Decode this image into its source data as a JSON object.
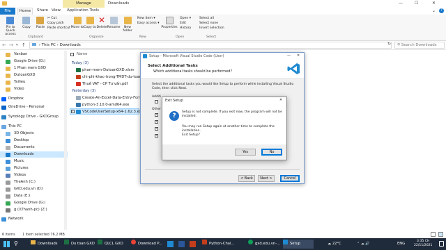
{
  "window": {
    "manage_tab": "Manage",
    "title": "Downloads",
    "minimize": "—",
    "maximize": "☐",
    "close": "✕"
  },
  "ribbon_tabs": [
    "File",
    "Home",
    "Share",
    "View",
    "Application Tools"
  ],
  "ribbon": {
    "pin_label": "Pin to Quick access",
    "copy_label": "Copy",
    "paste_label": "Paste",
    "cut": "Cut",
    "copy_path": "Copy path",
    "paste_shortcut": "Paste shortcut",
    "clipboard_group": "Clipboard",
    "move_to": "Move to",
    "copy_to": "Copy to",
    "delete": "Delete",
    "rename": "Rename",
    "organize_group": "Organize",
    "new_folder": "New folder",
    "new_item": "New item",
    "easy_access": "Easy access",
    "new_group": "New",
    "properties": "Properties",
    "open": "Open",
    "edit": "Edit",
    "history": "History",
    "open_group": "Open",
    "select_all": "Select all",
    "select_none": "Select none",
    "invert_selection": "Invert selection",
    "select_group": "Select"
  },
  "address": {
    "path": [
      "This PC",
      "Downloads"
    ],
    "search_placeholder": "Search Downloads"
  },
  "nav": [
    "Vanban",
    "Google Drive (G:)",
    "1 Phan mem GXD",
    "DutoanGXD",
    "Tailieu",
    "Video",
    "Dropbox",
    "OneDrive - Personal",
    "Synology Drive - GXDGroup",
    "This PC",
    "3D Objects",
    "Desktop",
    "Documents",
    "Downloads",
    "Music",
    "Pictures",
    "Videos",
    "TheAnh (C:)",
    "GXD.edu.vn (D:)",
    "Data (E:)",
    "Google Drive (G:)",
    "g (\\\\Thanh-pc) (Z:)",
    "Network"
  ],
  "list": {
    "column_name": "Name",
    "group_today": "Today (3)",
    "today": [
      "phan-mem-DutoanGXD.xlsm",
      "chi-phi-khac-trong-TMDT-du-toan.pptx",
      "Thuế VAT - CP Tư vấn.pdf"
    ],
    "group_yesterday": "Yesterday (3)",
    "yesterday": [
      "Create-An-Excel-Data-Entry-Form-With",
      "python-3.10.0-amd64.exe",
      "VSCodeUserSetup-x64-1.62.3.exe"
    ]
  },
  "setup": {
    "title": "Setup - Microsoft Visual Studio Code (User)",
    "heading": "Select Additional Tasks",
    "subheading": "Which additional tasks should be performed?",
    "body": "Select the additional tasks you would like Setup to perform while installing Visual Studio Code, then click Next.",
    "label_additional": "Additi",
    "label_other": "Other",
    "back": "< Back",
    "next": "Next >",
    "cancel": "Cancel"
  },
  "exit_dialog": {
    "title": "Exit Setup",
    "message": "Setup is not complete. If you exit now, the program will not be installed.",
    "message2": "You may run Setup again at another time to complete the installation.",
    "question": "Exit Setup?",
    "yes": "Yes",
    "no": "No",
    "close": "✕"
  },
  "status": {
    "items": "6 items",
    "selected": "1 item selected  76.2 MB"
  },
  "taskbar": {
    "apps": [
      "Downloads",
      "Du toan GXD",
      "QLCL GXD",
      "Download P...",
      "Python-Chal...",
      "gxd.edu.vn-...",
      "Setup"
    ],
    "temp": "22°C",
    "lang": "ENG",
    "time": "3:35 CH",
    "date": "22/11/2021"
  },
  "colors": {
    "accent": "#0078d7",
    "vscode_blue": "#1f8ad2",
    "folder_yellow": "#e9b64a",
    "taskbar": "#1f2a3a"
  }
}
